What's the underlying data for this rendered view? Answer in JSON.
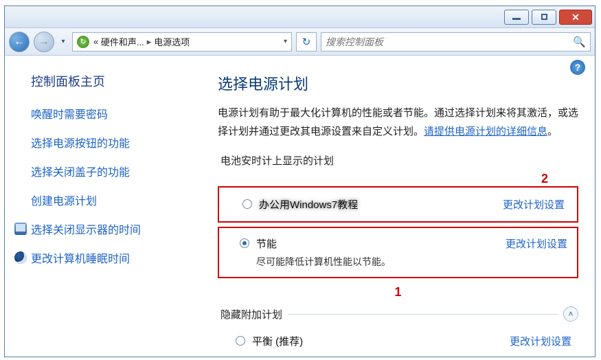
{
  "breadcrumb": {
    "level1": "硬件和声...",
    "level2": "电源选项"
  },
  "search": {
    "placeholder": "搜索控制面板"
  },
  "sidebar": {
    "home": "控制面板主页",
    "items": [
      "唤醒时需要密码",
      "选择电源按钮的功能",
      "选择关闭盖子的功能",
      "创建电源计划",
      "选择关闭显示器的时间",
      "更改计算机睡眠时间"
    ]
  },
  "main": {
    "title": "选择电源计划",
    "desc_pre": "电源计划有助于最大化计算机的性能或者节能。通过选择计划来将其激活，或选择计划并通过更改其电源设置来自定义计划。",
    "desc_link": "请提供电源计划的详细信息",
    "desc_post": "。",
    "section_battery": "电池安时计上显示的计划",
    "section_hidden": "隐藏附加计划",
    "plans": [
      {
        "name": "办公用Windows7教程",
        "desc": "",
        "change": "更改计划设置",
        "selected": false,
        "blur": true
      },
      {
        "name": "节能",
        "desc": "尽可能降低计算机性能以节能。",
        "change": "更改计划设置",
        "selected": true,
        "blur": false
      },
      {
        "name": "平衡 (推荐)",
        "desc": "",
        "change": "更改计划设置",
        "selected": false,
        "blur": false
      }
    ]
  },
  "annotations": {
    "one": "1",
    "two": "2"
  }
}
